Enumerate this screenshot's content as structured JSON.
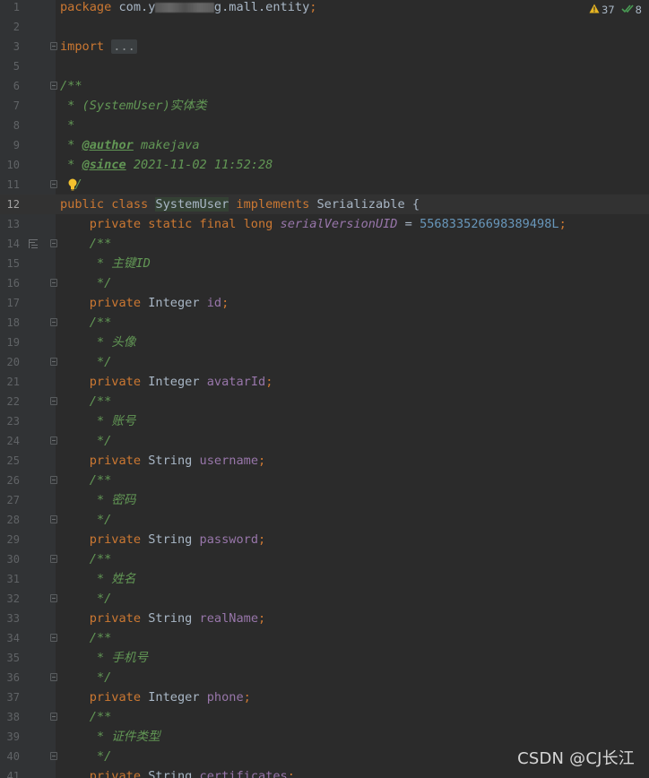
{
  "editor": {
    "current_line": 12,
    "inspections": {
      "warnings": "37",
      "weak_warnings": "8"
    },
    "watermark": "CSDN @CJ长江"
  },
  "lines": [
    {
      "n": "1",
      "tokens": [
        [
          "kw",
          "package "
        ],
        [
          "",
          "com.y"
        ],
        [
          "blur",
          "uanjiang"
        ],
        [
          "",
          "g.mall.entity"
        ],
        [
          "kw",
          ";"
        ]
      ]
    },
    {
      "n": "2",
      "tokens": []
    },
    {
      "n": "3",
      "fold": true,
      "tokens": [
        [
          "kw",
          "import "
        ],
        [
          "folded",
          "..."
        ]
      ]
    },
    {
      "n": "5",
      "tokens": []
    },
    {
      "n": "6",
      "fold": true,
      "tokens": [
        [
          "cm",
          "/**"
        ]
      ]
    },
    {
      "n": "7",
      "tokens": [
        [
          "cm",
          " * (SystemUser)实体类"
        ]
      ]
    },
    {
      "n": "8",
      "tokens": [
        [
          "cm",
          " *"
        ]
      ]
    },
    {
      "n": "9",
      "tokens": [
        [
          "cm",
          " * "
        ],
        [
          "tag",
          "@author"
        ],
        [
          "cm",
          " makejava"
        ]
      ]
    },
    {
      "n": "10",
      "tokens": [
        [
          "cm",
          " * "
        ],
        [
          "tag",
          "@since"
        ],
        [
          "cm",
          " 2021-11-02 11:52:28"
        ]
      ]
    },
    {
      "n": "11",
      "fold": true,
      "bulb": true,
      "tokens": [
        [
          "cm",
          "  /"
        ]
      ]
    },
    {
      "n": "12",
      "tokens": [
        [
          "kw",
          "public class "
        ],
        [
          "hl",
          "SystemUser"
        ],
        [
          "kw",
          " implements "
        ],
        [
          "",
          "Serializable {"
        ]
      ]
    },
    {
      "n": "13",
      "tokens": [
        [
          "",
          "    "
        ],
        [
          "kw",
          "private static final long "
        ],
        [
          "sfld",
          "serialVersionUID"
        ],
        [
          "",
          " = "
        ],
        [
          "num",
          "556833526698389498L"
        ],
        [
          "kw",
          ";"
        ]
      ]
    },
    {
      "n": "14",
      "fold": true,
      "gicon": true,
      "tokens": [
        [
          "cm",
          "    /**"
        ]
      ]
    },
    {
      "n": "15",
      "tokens": [
        [
          "cm",
          "     * 主键ID"
        ]
      ]
    },
    {
      "n": "16",
      "fold": true,
      "tokens": [
        [
          "cm",
          "     */"
        ]
      ]
    },
    {
      "n": "17",
      "tokens": [
        [
          "",
          "    "
        ],
        [
          "kw",
          "private "
        ],
        [
          "",
          "Integer "
        ],
        [
          "fld",
          "id"
        ],
        [
          "kw",
          ";"
        ]
      ]
    },
    {
      "n": "18",
      "fold": true,
      "tokens": [
        [
          "cm",
          "    /**"
        ]
      ]
    },
    {
      "n": "19",
      "tokens": [
        [
          "cm",
          "     * 头像"
        ]
      ]
    },
    {
      "n": "20",
      "fold": true,
      "tokens": [
        [
          "cm",
          "     */"
        ]
      ]
    },
    {
      "n": "21",
      "tokens": [
        [
          "",
          "    "
        ],
        [
          "kw",
          "private "
        ],
        [
          "",
          "Integer "
        ],
        [
          "fld",
          "avatarId"
        ],
        [
          "kw",
          ";"
        ]
      ]
    },
    {
      "n": "22",
      "fold": true,
      "tokens": [
        [
          "cm",
          "    /**"
        ]
      ]
    },
    {
      "n": "23",
      "tokens": [
        [
          "cm",
          "     * 账号"
        ]
      ]
    },
    {
      "n": "24",
      "fold": true,
      "tokens": [
        [
          "cm",
          "     */"
        ]
      ]
    },
    {
      "n": "25",
      "tokens": [
        [
          "",
          "    "
        ],
        [
          "kw",
          "private "
        ],
        [
          "",
          "String "
        ],
        [
          "fld",
          "username"
        ],
        [
          "kw",
          ";"
        ]
      ]
    },
    {
      "n": "26",
      "fold": true,
      "tokens": [
        [
          "cm",
          "    /**"
        ]
      ]
    },
    {
      "n": "27",
      "tokens": [
        [
          "cm",
          "     * 密码"
        ]
      ]
    },
    {
      "n": "28",
      "fold": true,
      "tokens": [
        [
          "cm",
          "     */"
        ]
      ]
    },
    {
      "n": "29",
      "tokens": [
        [
          "",
          "    "
        ],
        [
          "kw",
          "private "
        ],
        [
          "",
          "String "
        ],
        [
          "fld",
          "password"
        ],
        [
          "kw",
          ";"
        ]
      ]
    },
    {
      "n": "30",
      "fold": true,
      "tokens": [
        [
          "cm",
          "    /**"
        ]
      ]
    },
    {
      "n": "31",
      "tokens": [
        [
          "cm",
          "     * 姓名"
        ]
      ]
    },
    {
      "n": "32",
      "fold": true,
      "tokens": [
        [
          "cm",
          "     */"
        ]
      ]
    },
    {
      "n": "33",
      "tokens": [
        [
          "",
          "    "
        ],
        [
          "kw",
          "private "
        ],
        [
          "",
          "String "
        ],
        [
          "fld",
          "realName"
        ],
        [
          "kw",
          ";"
        ]
      ]
    },
    {
      "n": "34",
      "fold": true,
      "tokens": [
        [
          "cm",
          "    /**"
        ]
      ]
    },
    {
      "n": "35",
      "tokens": [
        [
          "cm",
          "     * 手机号"
        ]
      ]
    },
    {
      "n": "36",
      "fold": true,
      "tokens": [
        [
          "cm",
          "     */"
        ]
      ]
    },
    {
      "n": "37",
      "tokens": [
        [
          "",
          "    "
        ],
        [
          "kw",
          "private "
        ],
        [
          "",
          "Integer "
        ],
        [
          "fld",
          "phone"
        ],
        [
          "kw",
          ";"
        ]
      ]
    },
    {
      "n": "38",
      "fold": true,
      "tokens": [
        [
          "cm",
          "    /**"
        ]
      ]
    },
    {
      "n": "39",
      "tokens": [
        [
          "cm",
          "     * 证件类型"
        ]
      ]
    },
    {
      "n": "40",
      "fold": true,
      "tokens": [
        [
          "cm",
          "     */"
        ]
      ]
    },
    {
      "n": "41",
      "tokens": [
        [
          "",
          "    "
        ],
        [
          "kw",
          "private "
        ],
        [
          "",
          "String "
        ],
        [
          "fld",
          "certificates"
        ],
        [
          "kw",
          ";"
        ]
      ]
    }
  ],
  "colors": {
    "background": "#2b2b2b",
    "gutter": "#313335",
    "current_line": "#323232",
    "keyword": "#cc7832",
    "comment": "#629755",
    "field": "#9876aa",
    "number": "#6897bb",
    "text": "#a9b7c6",
    "warning": "#e6b422",
    "check": "#499c54"
  }
}
